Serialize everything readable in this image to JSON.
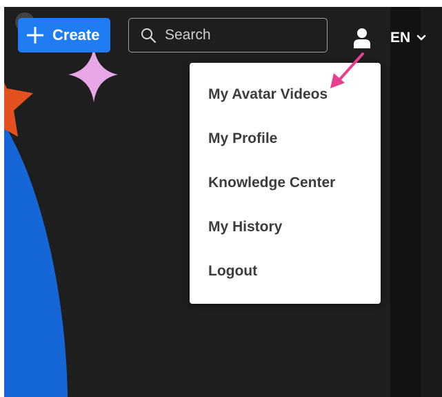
{
  "header": {
    "create_label": "Create",
    "search_placeholder": "Search",
    "language": "EN"
  },
  "user_menu": {
    "items": [
      {
        "label": "My Avatar Videos"
      },
      {
        "label": "My Profile"
      },
      {
        "label": "Knowledge Center"
      },
      {
        "label": "My History"
      },
      {
        "label": "Logout"
      }
    ]
  },
  "icons": {
    "create": "plus-icon",
    "search": "search-icon",
    "user": "user-icon",
    "language": "chevron-down-icon"
  },
  "colors": {
    "create_button": "#1f7cf2",
    "background": "#1e1e1e",
    "annotation_arrow": "#e8408e",
    "sparkle": "#e7a6e6",
    "star": "#e3521e",
    "arc": "#1566d6"
  }
}
